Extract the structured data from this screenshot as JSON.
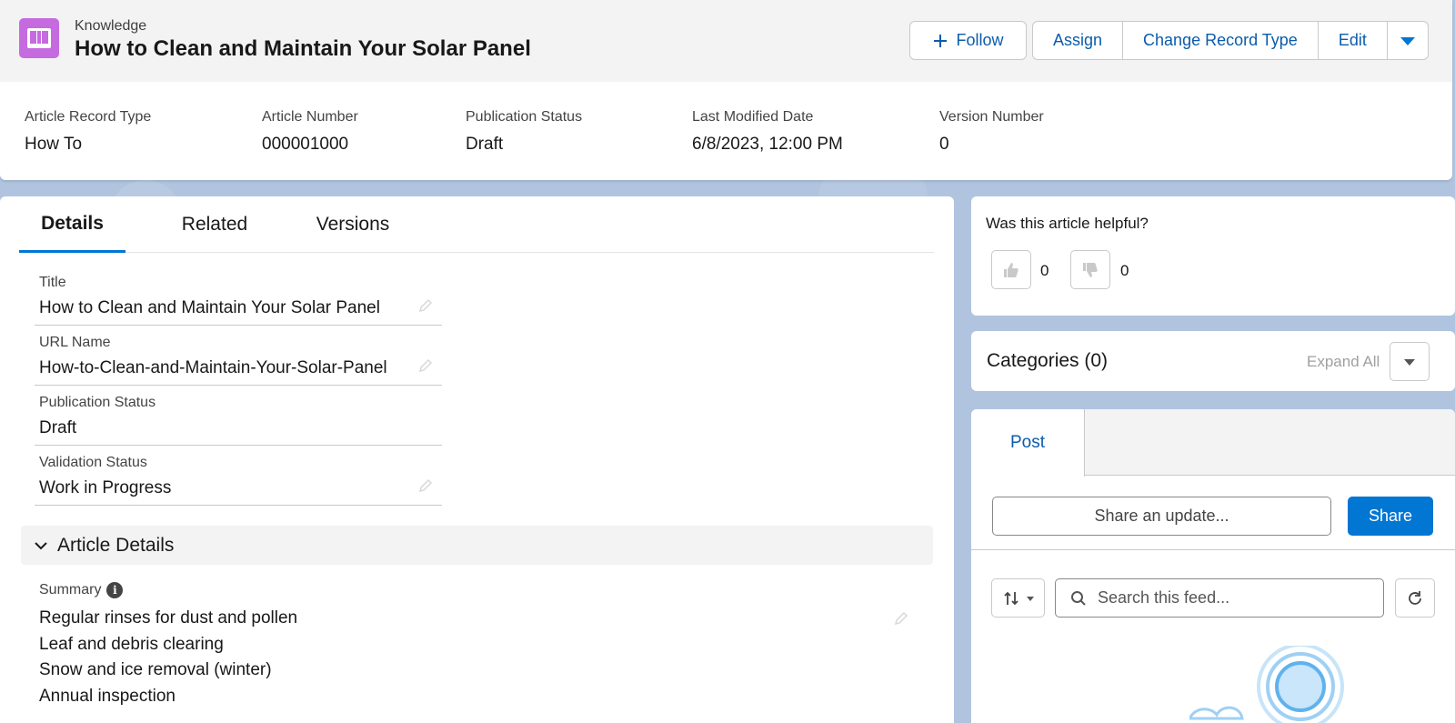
{
  "header": {
    "object_label": "Knowledge",
    "record_title": "How to Clean and Maintain Your Solar Panel",
    "actions": {
      "follow": "Follow",
      "assign": "Assign",
      "change_record_type": "Change Record Type",
      "edit": "Edit"
    },
    "highlights": [
      {
        "label": "Article Record Type",
        "value": "How To"
      },
      {
        "label": "Article Number",
        "value": "000001000"
      },
      {
        "label": "Publication Status",
        "value": "Draft"
      },
      {
        "label": "Last Modified Date",
        "value": "6/8/2023, 12:00 PM"
      },
      {
        "label": "Version Number",
        "value": "0"
      }
    ]
  },
  "tabs": [
    "Details",
    "Related",
    "Versions"
  ],
  "details": {
    "fields": [
      {
        "label": "Title",
        "value": "How to Clean and Maintain Your Solar Panel"
      },
      {
        "label": "URL Name",
        "value": "How-to-Clean-and-Maintain-Your-Solar-Panel"
      },
      {
        "label": "Publication Status",
        "value": "Draft"
      },
      {
        "label": "Validation Status",
        "value": "Work in Progress"
      }
    ],
    "section_title": "Article Details",
    "summary": {
      "label": "Summary",
      "lines": [
        "Regular rinses for dust and pollen",
        "Leaf and debris clearing",
        "Snow and ice removal (winter)",
        "Annual inspection"
      ]
    }
  },
  "helpful": {
    "question": "Was this article helpful?",
    "up_count": "0",
    "down_count": "0"
  },
  "categories": {
    "title": "Categories (0)",
    "expand_all": "Expand All"
  },
  "feed": {
    "tab_post": "Post",
    "share_placeholder": "Share an update...",
    "share_button": "Share",
    "search_placeholder": "Search this feed..."
  },
  "colors": {
    "brand": "#0176d3",
    "link": "#0b5cab",
    "app_icon": "#c66ae0",
    "page_bg": "#b0c4df"
  }
}
